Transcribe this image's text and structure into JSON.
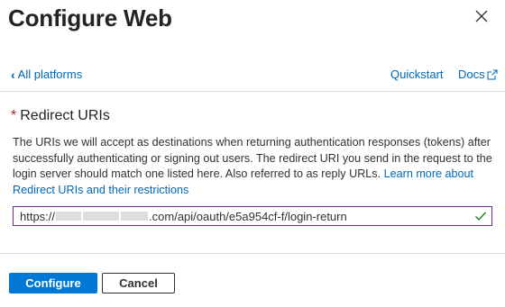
{
  "header": {
    "title": "Configure Web",
    "close_icon": "close-icon"
  },
  "nav": {
    "back_label": "All platforms",
    "quickstart_label": "Quickstart",
    "docs_label": "Docs"
  },
  "redirect": {
    "required_marker": "*",
    "label": "Redirect URIs",
    "description": "The URIs we will accept as destinations when returning authentication responses (tokens) after successfully authenticating or signing out users. The redirect URI you send in the request to the login server should match one listed here. Also referred to as reply URLs.",
    "learn_more_link": "Learn more about Redirect URIs and their restrictions",
    "uri_prefix": "https://",
    "uri_suffix": ".com/api/oauth/e5a954cf-f/login-return",
    "valid_icon": "checkmark-icon",
    "colors": {
      "link": "#0067b8",
      "required": "#a4262c",
      "field_border": "#6b2e8c",
      "valid": "#107c10"
    }
  },
  "footer": {
    "configure_label": "Configure",
    "cancel_label": "Cancel",
    "primary_color": "#0078d4"
  }
}
